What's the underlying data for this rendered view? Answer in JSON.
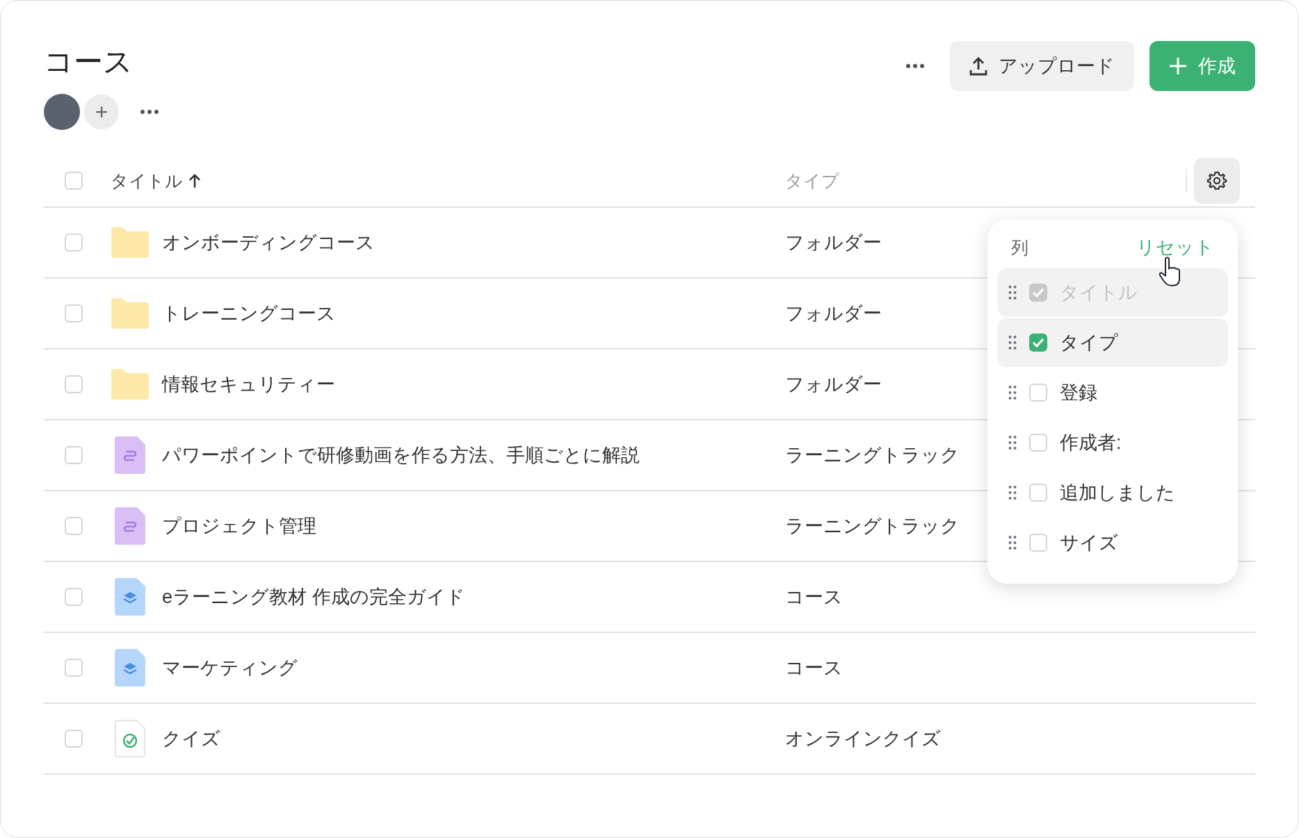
{
  "page": {
    "title": "コース"
  },
  "members": {
    "add": "+"
  },
  "actions": {
    "upload": "アップロード",
    "create": "作成"
  },
  "table": {
    "all_checked": false,
    "columns": [
      {
        "label": "タイトル",
        "sorted": true
      },
      {
        "label": "タイプ",
        "sorted": false
      }
    ],
    "rows": [
      {
        "kind": "folder",
        "title": "オンボーディングコース",
        "type": "フォルダー",
        "checked": false
      },
      {
        "kind": "folder",
        "title": "トレーニングコース",
        "type": "フォルダー",
        "checked": false
      },
      {
        "kind": "folder",
        "title": "情報セキュリティー",
        "type": "フォルダー",
        "checked": false
      },
      {
        "kind": "track",
        "title": "パワーポイントで研修動画を作る方法、手順ごとに解説",
        "type": "ラーニングトラック",
        "checked": false
      },
      {
        "kind": "track",
        "title": "プロジェクト管理",
        "type": "ラーニングトラック",
        "checked": false
      },
      {
        "kind": "course",
        "title": "eラーニング教材 作成の完全ガイド",
        "type": "コース",
        "checked": false
      },
      {
        "kind": "course",
        "title": "マーケティング",
        "type": "コース",
        "checked": false
      },
      {
        "kind": "quiz",
        "title": "クイズ",
        "type": "オンラインクイズ",
        "checked": false
      }
    ]
  },
  "column_menu": {
    "title": "列",
    "reset": "リセット",
    "items": [
      {
        "label": "タイトル",
        "checked": true,
        "disabled": true,
        "hovered": false
      },
      {
        "label": "タイプ",
        "checked": true,
        "disabled": false,
        "hovered": true
      },
      {
        "label": "登録",
        "checked": false,
        "disabled": false,
        "hovered": false
      },
      {
        "label": "作成者:",
        "checked": false,
        "disabled": false,
        "hovered": false
      },
      {
        "label": "追加しました",
        "checked": false,
        "disabled": false,
        "hovered": false
      },
      {
        "label": "サイズ",
        "checked": false,
        "disabled": false,
        "hovered": false
      }
    ]
  }
}
